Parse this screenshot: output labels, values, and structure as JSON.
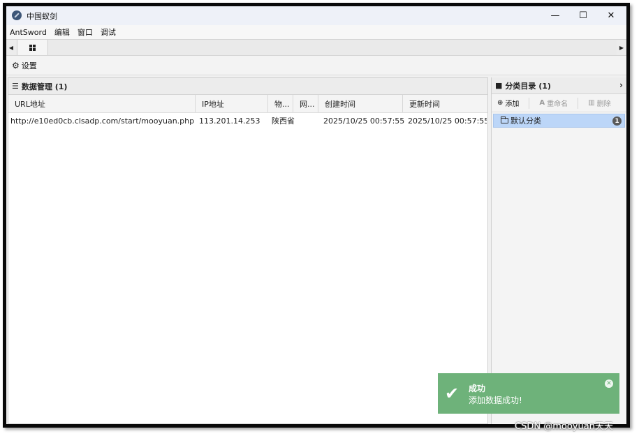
{
  "window": {
    "title": "中国蚁剑",
    "minimize": "—",
    "maximize": "☐",
    "close": "✕"
  },
  "menu": [
    "AntSword",
    "编辑",
    "窗口",
    "调试"
  ],
  "tabs": {
    "left_arrow": "◀",
    "right_arrow": "▶"
  },
  "toolbar": {
    "settings_label": "设置",
    "settings_icon": "gear-icon"
  },
  "data_panel": {
    "title": "数据管理 (1)",
    "columns": [
      "URL地址",
      "IP地址",
      "物...",
      "网...",
      "创建时间",
      "更新时间"
    ],
    "rows": [
      {
        "url": "http://e10ed0cb.clsadp.com/start/mooyuan.php",
        "ip": "113.201.14.253",
        "location": "陕西省",
        "network": "",
        "created": "2025/10/25 00:57:55",
        "updated": "2025/10/25 00:57:55"
      }
    ]
  },
  "category_panel": {
    "title": "分类目录 (1)",
    "add_label": "添加",
    "rename_label": "重命名",
    "delete_label": "删除",
    "items": [
      {
        "label": "默认分类",
        "count": "1"
      }
    ]
  },
  "toast": {
    "title": "成功",
    "message": "添加数据成功!",
    "color": "#6eb27a"
  },
  "watermark": "CSDN @mooyuan天天"
}
